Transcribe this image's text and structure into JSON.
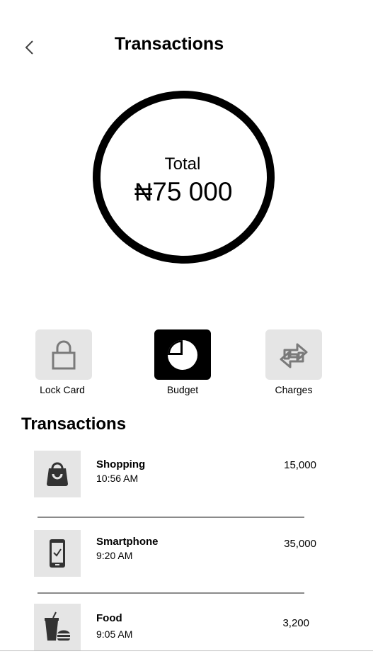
{
  "header": {
    "title": "Transactions",
    "back_icon": "chevron-left-icon"
  },
  "summary": {
    "label": "Total",
    "currency": "₦",
    "amount": "75 000"
  },
  "actions": [
    {
      "label": "Lock Card",
      "icon": "lock-icon",
      "selected": false
    },
    {
      "label": "Budget",
      "icon": "pie-chart-icon",
      "selected": true
    },
    {
      "label": "Charges",
      "icon": "swap-arrows-icon",
      "selected": false
    }
  ],
  "section_title": "Transactions",
  "transactions": [
    {
      "name": "Shopping",
      "time": "10:56 AM",
      "amount": "15,000",
      "icon": "shopping-bag-icon"
    },
    {
      "name": "Smartphone",
      "time": "9:20 AM",
      "amount": "35,000",
      "icon": "smartphone-icon"
    },
    {
      "name": "Food",
      "time": "9:05 AM",
      "amount": "3,200",
      "icon": "food-icon"
    }
  ],
  "colors": {
    "tile_bg": "#e5e5e5",
    "selected_tile_bg": "#000000",
    "divider": "#8a8a8a"
  }
}
